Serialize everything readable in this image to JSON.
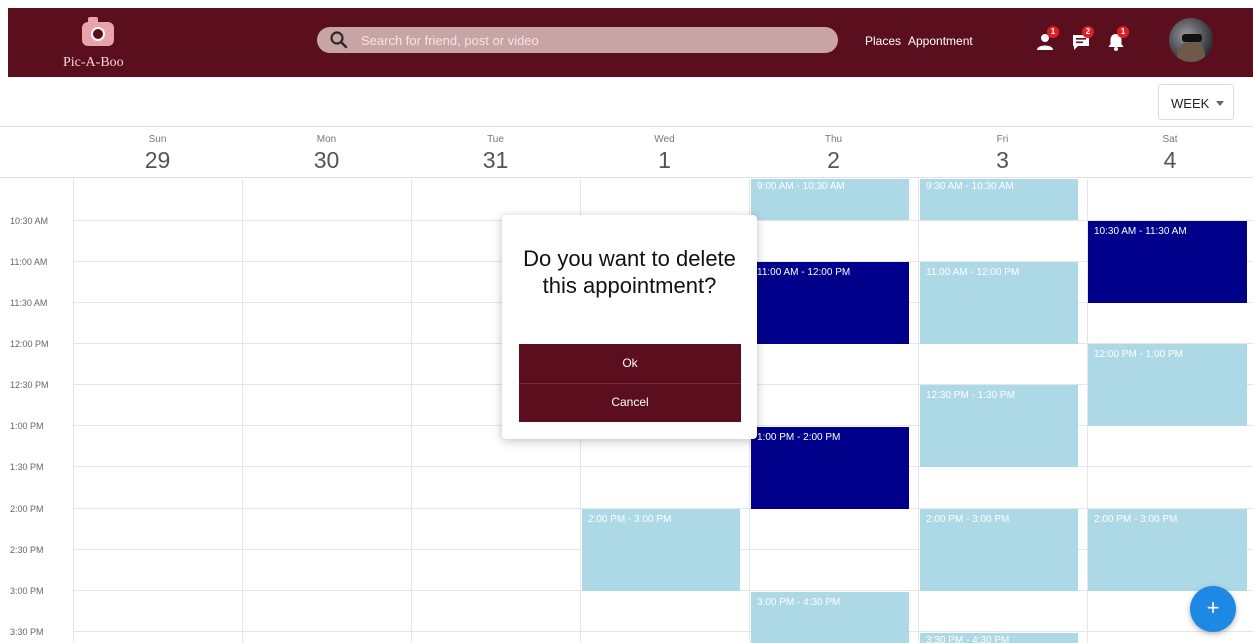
{
  "header": {
    "logo_text": "Pic-A-Boo",
    "search_placeholder": "Search for friend, post or video",
    "nav": {
      "places": "Places",
      "appointment": "Appontment"
    },
    "badges": {
      "friends": "1",
      "messages": "2",
      "notifications": "1"
    }
  },
  "toolbar": {
    "view_label": "WEEK"
  },
  "days": [
    {
      "name": "Sun",
      "num": "29"
    },
    {
      "name": "Mon",
      "num": "30"
    },
    {
      "name": "Tue",
      "num": "31"
    },
    {
      "name": "Wed",
      "num": "1"
    },
    {
      "name": "Thu",
      "num": "2"
    },
    {
      "name": "Fri",
      "num": "3"
    },
    {
      "name": "Sat",
      "num": "4"
    }
  ],
  "times": [
    "10:30 AM",
    "11:00 AM",
    "11:30 AM",
    "12:00 PM",
    "12:30 PM",
    "1:00 PM",
    "1:30 PM",
    "2:00 PM",
    "2:30 PM",
    "3:00 PM",
    "3:30 PM"
  ],
  "events": [
    {
      "label": "9:00 AM - 10:30 AM",
      "day": "Thu"
    },
    {
      "label": "9:30 AM - 10:30 AM",
      "day": "Fri"
    },
    {
      "label": "10:30 AM - 11:30 AM",
      "day": "Sat"
    },
    {
      "label": "11:00 AM - 12:00 PM",
      "day": "Thu"
    },
    {
      "label": "11:00 AM - 12:00 PM",
      "day": "Fri"
    },
    {
      "label": "12:00 PM - 1:00 PM",
      "day": "Sat"
    },
    {
      "label": "12:30 PM - 1:30 PM",
      "day": "Fri"
    },
    {
      "label": "1:00 PM - 2:00 PM",
      "day": "Thu"
    },
    {
      "label": "2:00 PM - 3:00 PM",
      "day": "Wed"
    },
    {
      "label": "2:00 PM - 3:00 PM",
      "day": "Fri"
    },
    {
      "label": "2:00 PM - 3:00 PM",
      "day": "Sat"
    },
    {
      "label": "3:00 PM - 4:30 PM",
      "day": "Thu"
    },
    {
      "label": "3:30 PM - 4:30 PM",
      "day": "Fri"
    }
  ],
  "dialog": {
    "title": "Do you want to delete this appointment?",
    "ok_label": "Ok",
    "cancel_label": "Cancel"
  },
  "fab_label": "+",
  "colors": {
    "brand": "#5b0f1e",
    "event_light": "#add8e6",
    "event_dark": "#00008b",
    "fab": "#1e88e5",
    "badge": "#e02020"
  }
}
